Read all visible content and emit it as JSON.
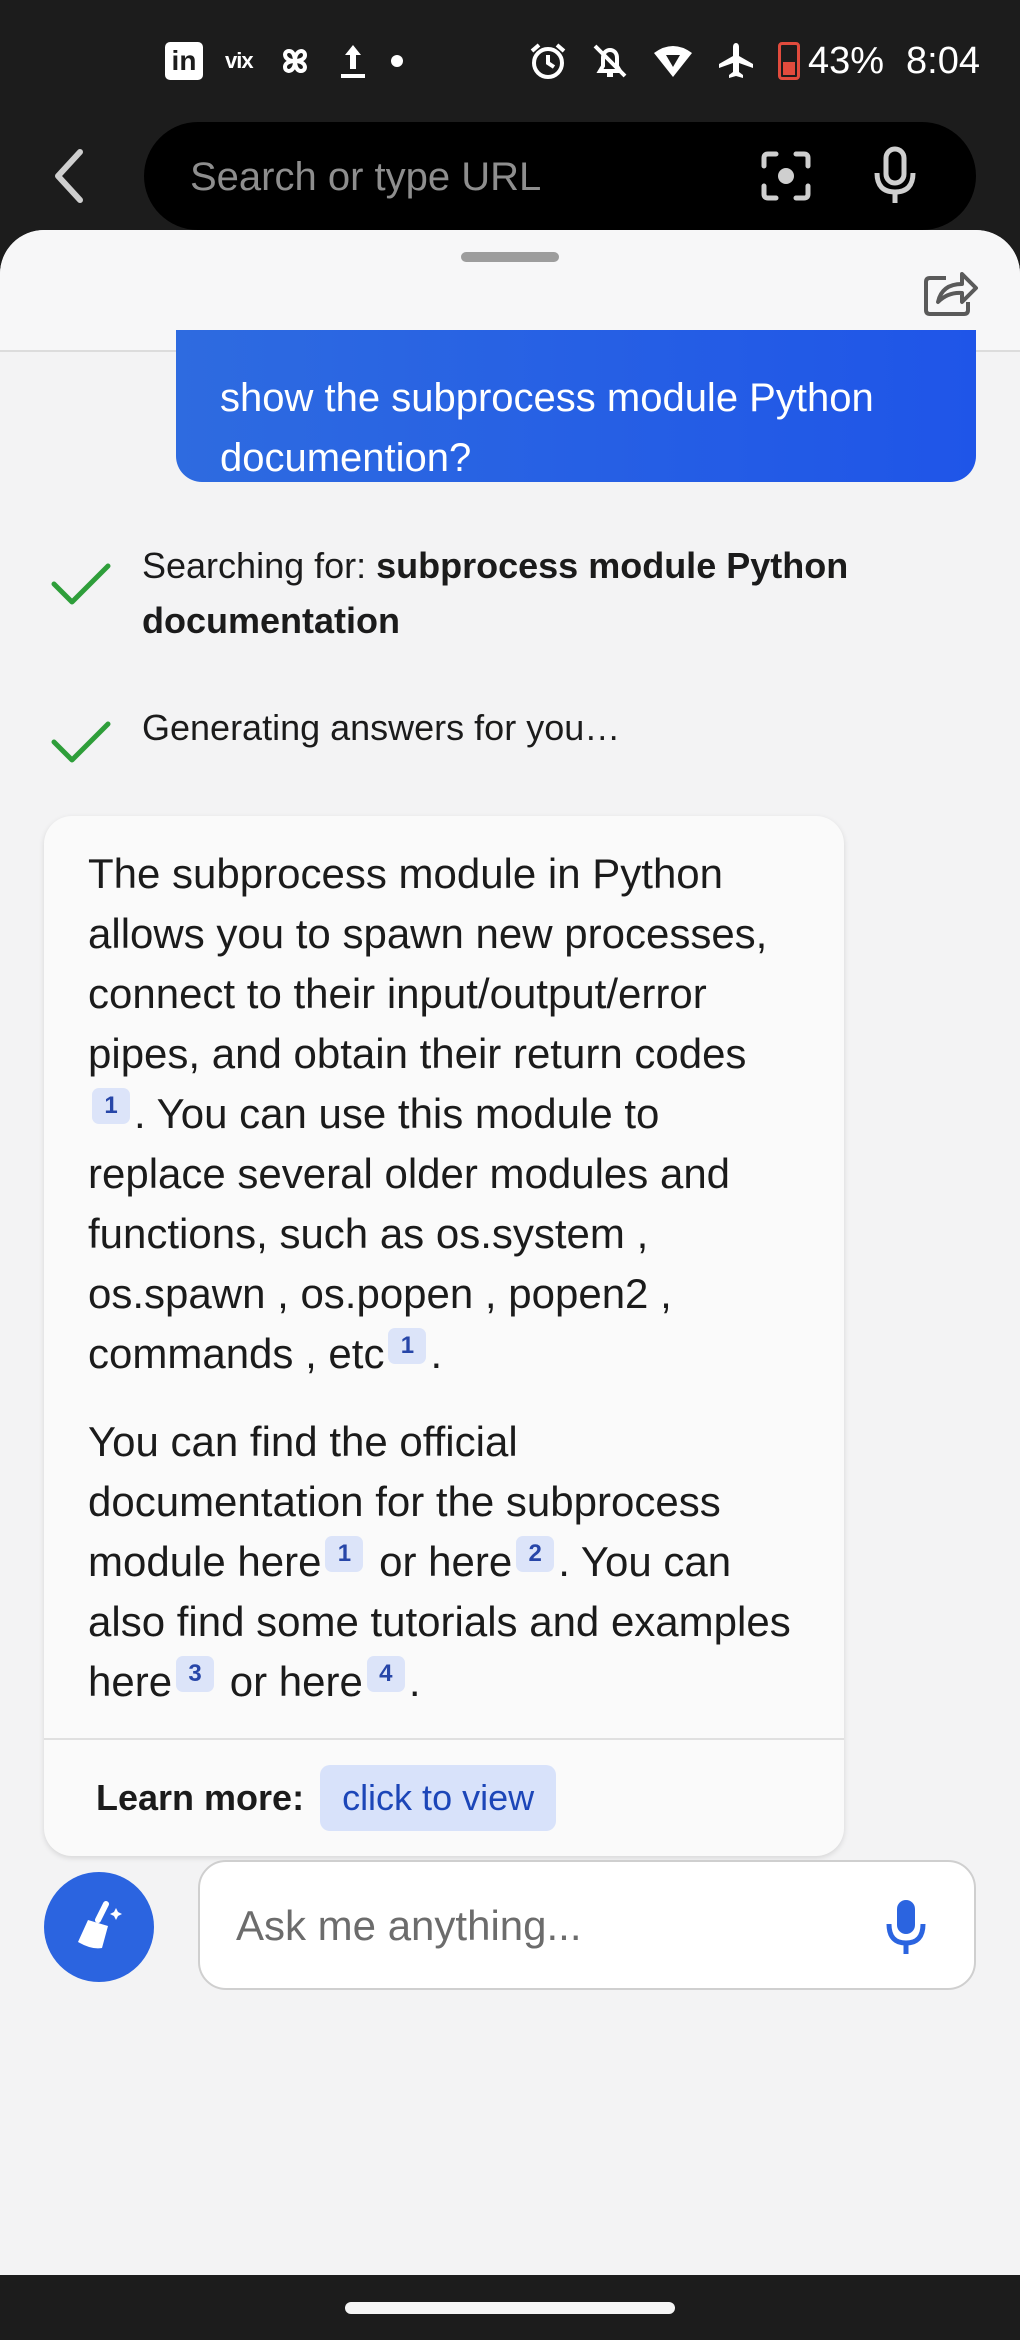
{
  "status_bar": {
    "battery_percent": "43%",
    "time": "8:04",
    "left_icons": [
      "linkedin-icon",
      "vix-icon",
      "pinwheel-icon",
      "upload-icon",
      "dot-icon"
    ],
    "right_icons": [
      "alarm-icon",
      "mute-icon",
      "wifi-icon",
      "airplane-icon",
      "battery-icon"
    ],
    "vix_label": "vix",
    "linkedin_label": "in"
  },
  "browser": {
    "url_placeholder": "Search or type URL"
  },
  "chat": {
    "user_message": "show the subprocess module Python documention?",
    "steps": [
      {
        "prefix": "Searching for: ",
        "bold": "subprocess module Python documentation"
      },
      {
        "prefix": "Generating answers for you…",
        "bold": ""
      }
    ],
    "answer": {
      "p1": {
        "a": "The subprocess module in Python allows you to spawn new processes, connect to their input/output/error pipes, and obtain their return codes ",
        "c1": "1",
        "b": ". You can use this module to replace several older modules and functions, such as os.system , os.spawn , os.popen , popen2 , commands , etc",
        "c2": "1",
        "end": "."
      },
      "p2": {
        "a": "You can find the official documentation for the subprocess module here",
        "c1": "1",
        "b": " or here",
        "c2": "2",
        "c": ". You can also find some tutorials and examples here",
        "c3": "3",
        "d": " or here",
        "c4": "4",
        "end": "."
      }
    },
    "learn_more_label": "Learn more:",
    "learn_more_button": "click to view",
    "input_placeholder": "Ask me anything..."
  },
  "colors": {
    "accent": "#2b64e0",
    "check": "#2e9e3a",
    "citation_bg": "#dce4f9"
  }
}
